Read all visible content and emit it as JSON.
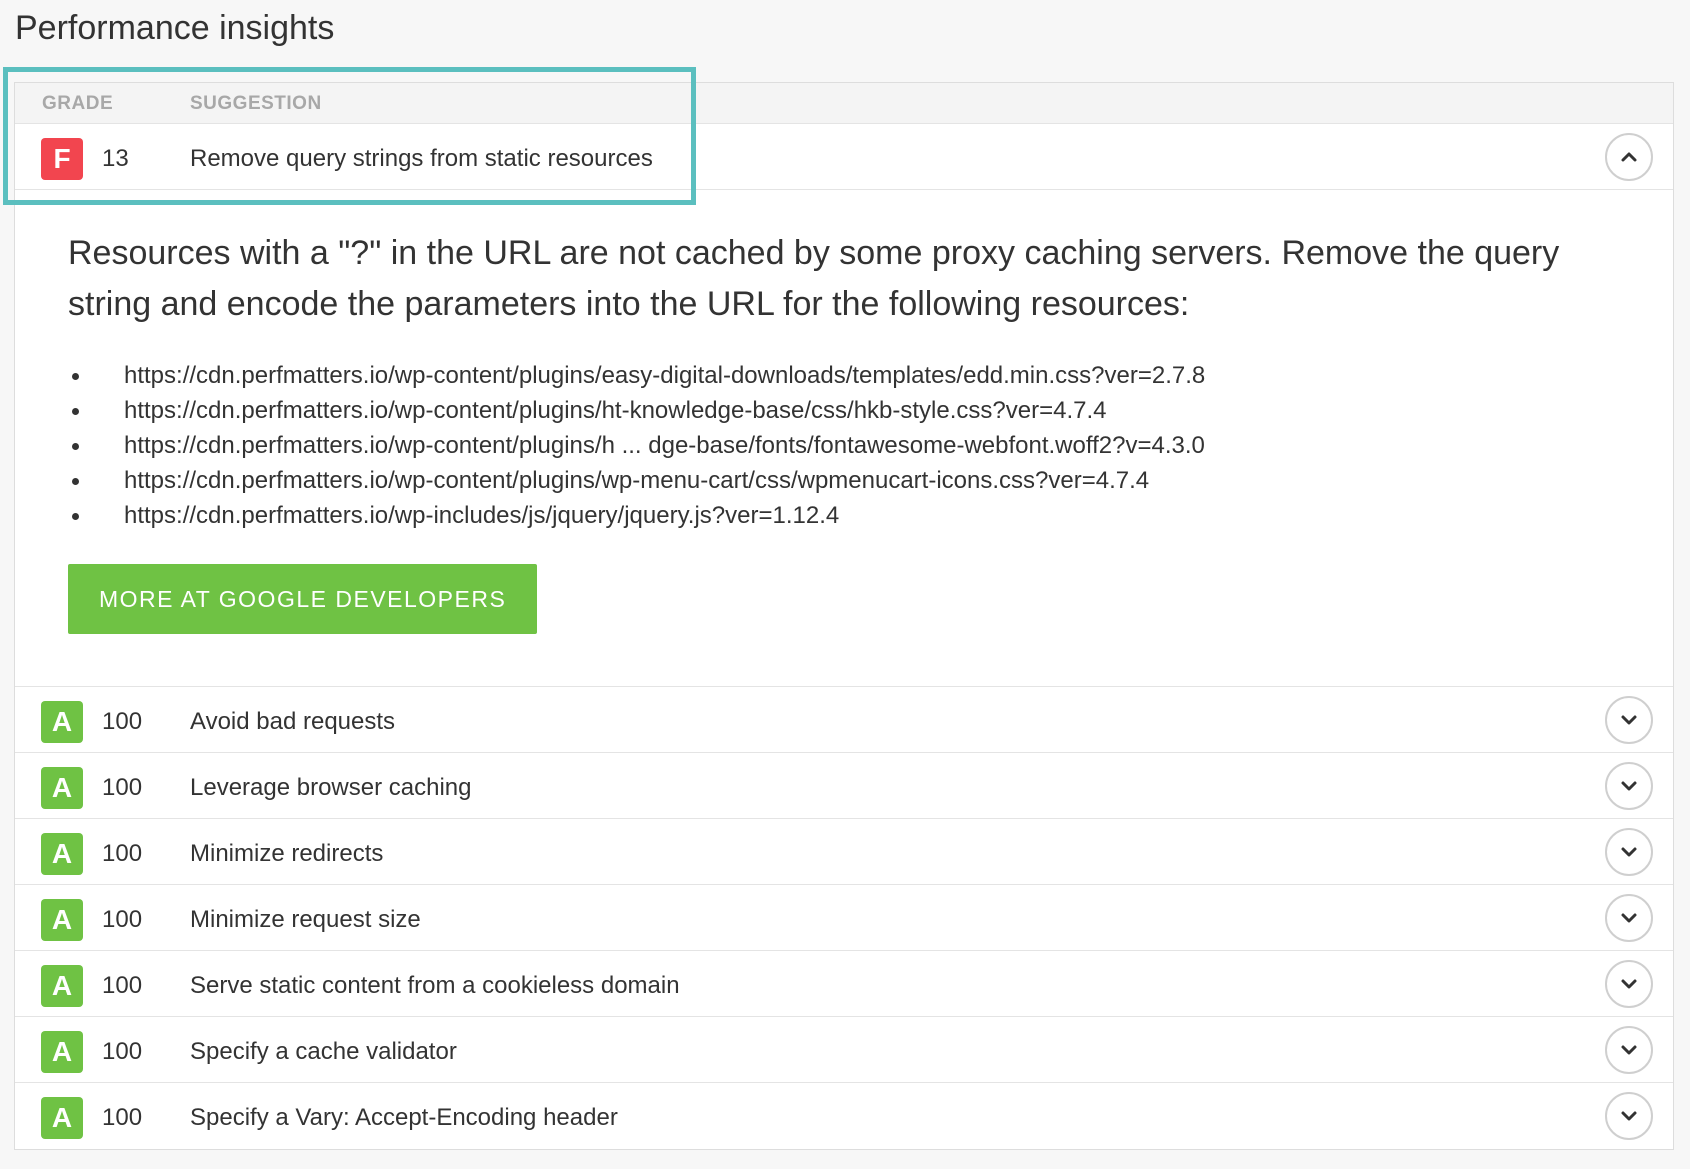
{
  "page": {
    "title": "Performance insights"
  },
  "table": {
    "headers": {
      "grade": "GRADE",
      "suggestion": "SUGGESTION"
    }
  },
  "expanded": {
    "grade": "F",
    "score": "13",
    "suggestion": "Remove query strings from static resources",
    "grade_color": "#f2454f",
    "toggle_icon": "chevron-up-icon",
    "description": "Resources with a \"?\" in the URL are not cached by some proxy caching servers. Remove the query string and encode the parameters into the URL for the following resources:",
    "resources": [
      "https://cdn.perfmatters.io/wp-content/plugins/easy-digital-downloads/templates/edd.min.css?ver=2.7.8",
      "https://cdn.perfmatters.io/wp-content/plugins/ht-knowledge-base/css/hkb-style.css?ver=4.7.4",
      "https://cdn.perfmatters.io/wp-content/plugins/h ... dge-base/fonts/fontawesome-webfont.woff2?v=4.3.0",
      "https://cdn.perfmatters.io/wp-content/plugins/wp-menu-cart/css/wpmenucart-icons.css?ver=4.7.4",
      "https://cdn.perfmatters.io/wp-includes/js/jquery/jquery.js?ver=1.12.4"
    ],
    "button_label": "MORE AT GOOGLE DEVELOPERS",
    "button_color": "#6fc244"
  },
  "rows": [
    {
      "grade": "A",
      "score": "100",
      "suggestion": "Avoid bad requests"
    },
    {
      "grade": "A",
      "score": "100",
      "suggestion": "Leverage browser caching"
    },
    {
      "grade": "A",
      "score": "100",
      "suggestion": "Minimize redirects"
    },
    {
      "grade": "A",
      "score": "100",
      "suggestion": "Minimize request size"
    },
    {
      "grade": "A",
      "score": "100",
      "suggestion": "Serve static content from a cookieless domain"
    },
    {
      "grade": "A",
      "score": "100",
      "suggestion": "Specify a cache validator"
    },
    {
      "grade": "A",
      "score": "100",
      "suggestion": "Specify a Vary: Accept-Encoding header"
    }
  ],
  "colors": {
    "grade_a": "#6fc244",
    "grade_f": "#f2454f",
    "highlight": "#5bbfbf"
  }
}
